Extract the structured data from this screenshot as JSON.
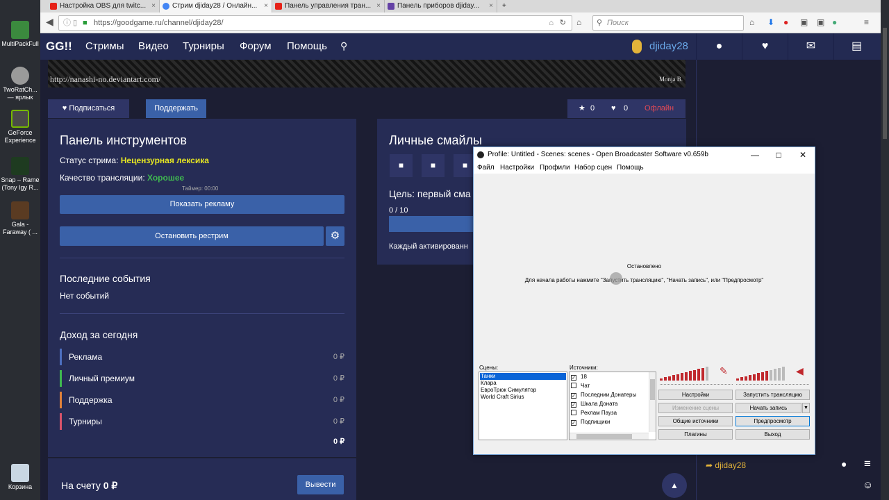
{
  "desktop": {
    "items": [
      {
        "label": "MultiPackFull"
      },
      {
        "label": "TwoRatCh... — ярлык"
      },
      {
        "label": "GeForce Experience"
      },
      {
        "label": "Snap – Rame (Tony Igy R..."
      },
      {
        "label": "Gala - Faraway ( ..."
      },
      {
        "label": "Корзина"
      }
    ]
  },
  "browser": {
    "tabs": [
      {
        "label": "Настройка OBS для twitc..."
      },
      {
        "label": "Стрим djiday28 / Онлайн..."
      },
      {
        "label": "Панель управления тран..."
      },
      {
        "label": "Панель приборов djiday..."
      }
    ],
    "new_tab": "+",
    "url": "https://goodgame.ru/channel/djiday28/",
    "search_placeholder": "Поиск"
  },
  "site": {
    "logo": "GG!!",
    "nav": [
      "Стримы",
      "Видео",
      "Турниры",
      "Форум",
      "Помощь"
    ],
    "username": "djiday28",
    "banner": {
      "left_text": "http://nanashi-no.deviantart.com/",
      "right_text": "Monja B."
    },
    "subscribe_label": "Подписаться",
    "support_label": "Поддержать",
    "stats": {
      "stars": "0",
      "likes": "0",
      "status": "Офлайн"
    },
    "tools": {
      "title": "Панель инструментов",
      "status_label": "Статус стрима:",
      "status_value": "Нецензурная лексика",
      "quality_label": "Качество трансляции:",
      "quality_value": "Хорошее",
      "timer": "Таймер: 00:00",
      "show_ad": "Показать рекламу",
      "stop_restream": "Остановить рестрим",
      "events_title": "Последние события",
      "events_empty": "Нет событий",
      "income_title": "Доход за сегодня",
      "income_rows": [
        {
          "label": "Реклама",
          "amount": "0 ₽",
          "color": "#4d6fbf"
        },
        {
          "label": "Личный премиум",
          "amount": "0 ₽",
          "color": "#3fb950"
        },
        {
          "label": "Поддержка",
          "amount": "0 ₽",
          "color": "#e0813a"
        },
        {
          "label": "Турниры",
          "amount": "0 ₽",
          "color": "#d9536b"
        }
      ],
      "income_total": "0 ₽",
      "balance_label": "На счету",
      "balance_value": "0 ₽",
      "withdraw": "Вывести"
    },
    "smiles": {
      "title": "Личные смайлы",
      "goal": "Цель: первый сма",
      "goal_progress": "0 / 10",
      "activated": "Каждый активированн"
    },
    "chat": {
      "user": "djiday28"
    }
  },
  "obs": {
    "title": "Profile: Untitled - Scenes: scenes - Open Broadcaster Software v0.659b",
    "menu": [
      "Файл",
      "Настройки",
      "Профили",
      "Набор сцен",
      "Помощь"
    ],
    "status": "Остановлено",
    "hint": "Для начала работы нажмите \"Запустить трансляцию\", \"Начать запись\", или \"Предпросмотр\"",
    "scenes_label": "Сцены:",
    "scenes": [
      "Танки",
      "Клара",
      "ЕвроТрюк Симулятор",
      "World Craft Sirius"
    ],
    "selected_scene": "Танки",
    "sources_label": "Источники:",
    "sources": [
      {
        "label": "18",
        "checked": true
      },
      {
        "label": "Чат",
        "checked": false
      },
      {
        "label": "Последнии Донатеры",
        "checked": true
      },
      {
        "label": "Шкала Доната",
        "checked": true
      },
      {
        "label": "Реклам Пауза",
        "checked": false
      },
      {
        "label": "Подпищики",
        "checked": true
      }
    ],
    "buttons": {
      "settings": "Настройки",
      "start_stream": "Запустить трансляцию",
      "scene_edit": "Изменение сцены",
      "start_record": "Начать запись",
      "global_sources": "Общие источники",
      "preview": "Предпросмотр",
      "plugins": "Плагины",
      "exit": "Выход"
    },
    "meter_color": "#c0282d"
  }
}
